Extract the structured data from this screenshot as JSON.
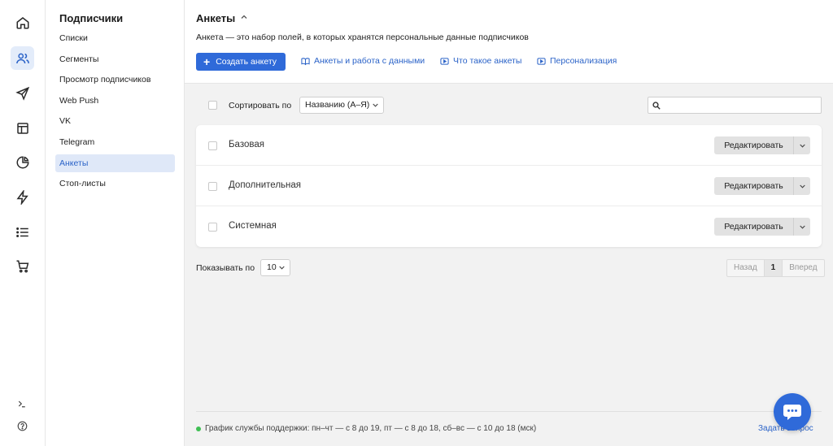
{
  "rail": {
    "items": [
      {
        "icon": "home-icon"
      },
      {
        "icon": "users-icon",
        "active": true
      },
      {
        "icon": "send-icon"
      },
      {
        "icon": "layout-icon"
      },
      {
        "icon": "pie-chart-icon"
      },
      {
        "icon": "lightning-icon"
      },
      {
        "icon": "list-icon"
      },
      {
        "icon": "cart-icon"
      }
    ],
    "bottom": [
      {
        "icon": "terminal-icon"
      },
      {
        "icon": "help-icon"
      }
    ]
  },
  "subnav": {
    "title": "Подписчики",
    "items": [
      {
        "label": "Списки"
      },
      {
        "label": "Сегменты"
      },
      {
        "label": "Просмотр подписчиков"
      },
      {
        "label": "Web Push"
      },
      {
        "label": "VK"
      },
      {
        "label": "Telegram"
      },
      {
        "label": "Анкеты",
        "active": true
      },
      {
        "label": "Стоп-листы"
      }
    ]
  },
  "header": {
    "title": "Анкеты",
    "description": "Анкета — это набор полей, в которых хранятся персональные данные подписчиков",
    "create_label": "Создать анкету",
    "links": [
      {
        "label": "Анкеты и работа с данными",
        "icon": "book-icon"
      },
      {
        "label": "Что такое анкеты",
        "icon": "video-icon"
      },
      {
        "label": "Персонализация",
        "icon": "video-icon"
      }
    ]
  },
  "toolbar": {
    "sort_label": "Сортировать по",
    "sort_value": "Названию (А–Я)",
    "search_placeholder": ""
  },
  "forms": [
    {
      "name": "Базовая",
      "action": "Редактировать"
    },
    {
      "name": "Дополнительная",
      "action": "Редактировать"
    },
    {
      "name": "Системная",
      "action": "Редактировать"
    }
  ],
  "pagination": {
    "show_label": "Показывать по",
    "page_size": "10",
    "prev": "Назад",
    "current": "1",
    "next": "Вперед"
  },
  "footer": {
    "support_text": "График службы поддержки: пн–чт — с 8 до 19, пт — с 8 до 18, сб–вс — с 10 до 18 (мск)",
    "ask_link": "Задать вопрос",
    "status_color": "#3fbf54"
  },
  "colors": {
    "accent": "#2f6ad9",
    "active_bg": "#dfe8f8"
  }
}
